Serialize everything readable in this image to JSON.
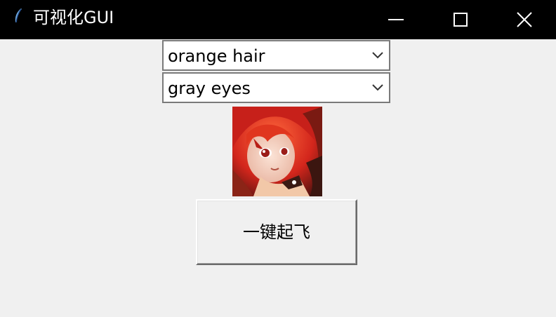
{
  "window": {
    "title": "可视化GUI",
    "icon": "feather-icon",
    "controls": [
      "minimize-icon",
      "maximize-icon",
      "close-icon"
    ]
  },
  "hair_select": {
    "value": "orange hair",
    "icon": "chevron-down-icon"
  },
  "eyes_select": {
    "value": "gray eyes",
    "icon": "chevron-down-icon"
  },
  "generated_image": {
    "subject": "anime-character-portrait"
  },
  "action_button": {
    "label": "一键起飞"
  },
  "colors": {
    "titlebar": "#000000",
    "window_bg": "#f0f0f0",
    "combo_border": "#7a7a7a"
  }
}
